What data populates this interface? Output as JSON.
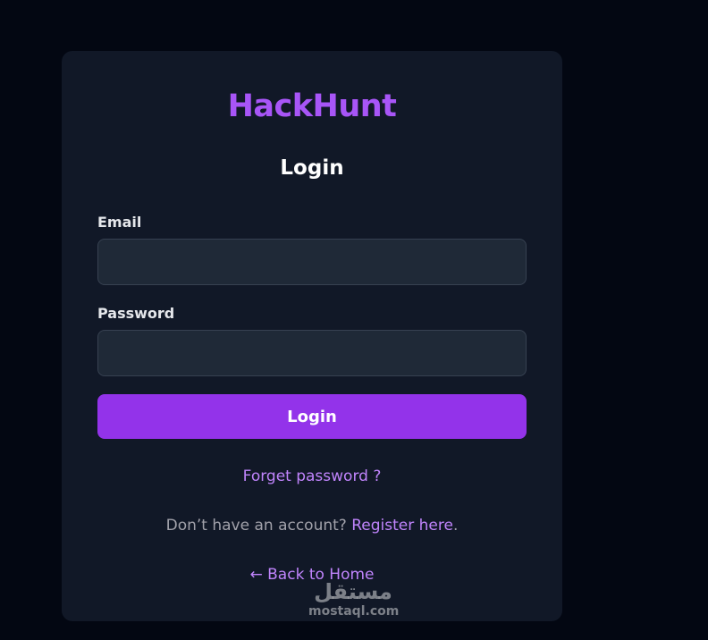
{
  "brand": "HackHunt",
  "form": {
    "title": "Login",
    "email_label": "Email",
    "email_value": "",
    "password_label": "Password",
    "password_value": "",
    "submit_label": "Login"
  },
  "links": {
    "forgot_password": "Forget password ?",
    "register_prompt": "Don’t have an account?",
    "register_link": "Register here",
    "register_suffix": ".",
    "back_home": "← Back to Home"
  },
  "watermark": {
    "arabic": "مستقل",
    "latin": "mostaql.com"
  },
  "colors": {
    "page_bg": "#030712",
    "card_bg": "#111827",
    "brand": "#a855f7",
    "button": "#9333ea",
    "link": "#c084fc"
  }
}
